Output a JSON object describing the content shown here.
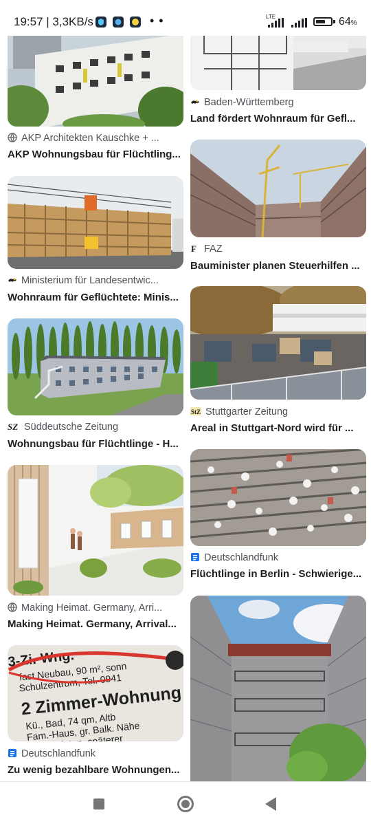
{
  "status_bar": {
    "time_speed": "19:57 | 3,3KB/s",
    "dots": "• •",
    "lte": "LTE",
    "battery_percent": "64",
    "battery_unit": "%",
    "battery_level": 0.64
  },
  "results": {
    "left": [
      {
        "source": "",
        "title": ""
      },
      {
        "source": "AKP Architekten Kauschke + ...",
        "title": "AKP Wohnungsbau für Flüchtling...",
        "icon": "globe-icon"
      },
      {
        "source": "Ministerium für Landesentwic...",
        "title": "Wohnraum für Geflüchtete: Minis...",
        "icon": "lion-emblem-icon"
      },
      {
        "source": "Süddeutsche Zeitung",
        "title": "Wohnungsbau für Flüchtlinge - H...",
        "icon": "sz-logo"
      },
      {
        "source": "Making Heimat. Germany, Arri...",
        "title": "Making Heimat. Germany, Arrival...",
        "icon": "globe-icon"
      },
      {
        "source": "Deutschlandfunk",
        "title": "Zu wenig bezahlbare Wohnungen...",
        "icon": "document-icon",
        "image_text": [
          "3-Zi.-Wng.",
          "fast Neubau, 90 m², sonn",
          "Schulzentrum, Tel. 0941",
          "2 Zimmer-Wohnung",
          "Kü., Bad, 74 qm, Altb",
          "Fam.-Haus, gr. Balk. Nähe",
          "vermieten, späterer"
        ]
      }
    ],
    "right": [
      {
        "source": "Baden-Württemberg",
        "title": "Land fördert Wohnraum für Gefl...",
        "icon": "lion-emblem-icon"
      },
      {
        "source": "FAZ",
        "title": "Bauminister planen Steuerhilfen ...",
        "icon": "faz-logo"
      },
      {
        "source": "Stuttgarter Zeitung",
        "title": "Areal in Stuttgart-Nord wird für ...",
        "icon": "stz-logo"
      },
      {
        "source": "Deutschlandfunk",
        "title": "Flüchtlinge in Berlin - Schwierige...",
        "icon": "document-icon"
      },
      {
        "source": "",
        "title": ""
      }
    ]
  },
  "colors": {
    "accent": "#1a73e8",
    "text": "#202124",
    "source": "#4d5156",
    "nav": "#757575"
  }
}
